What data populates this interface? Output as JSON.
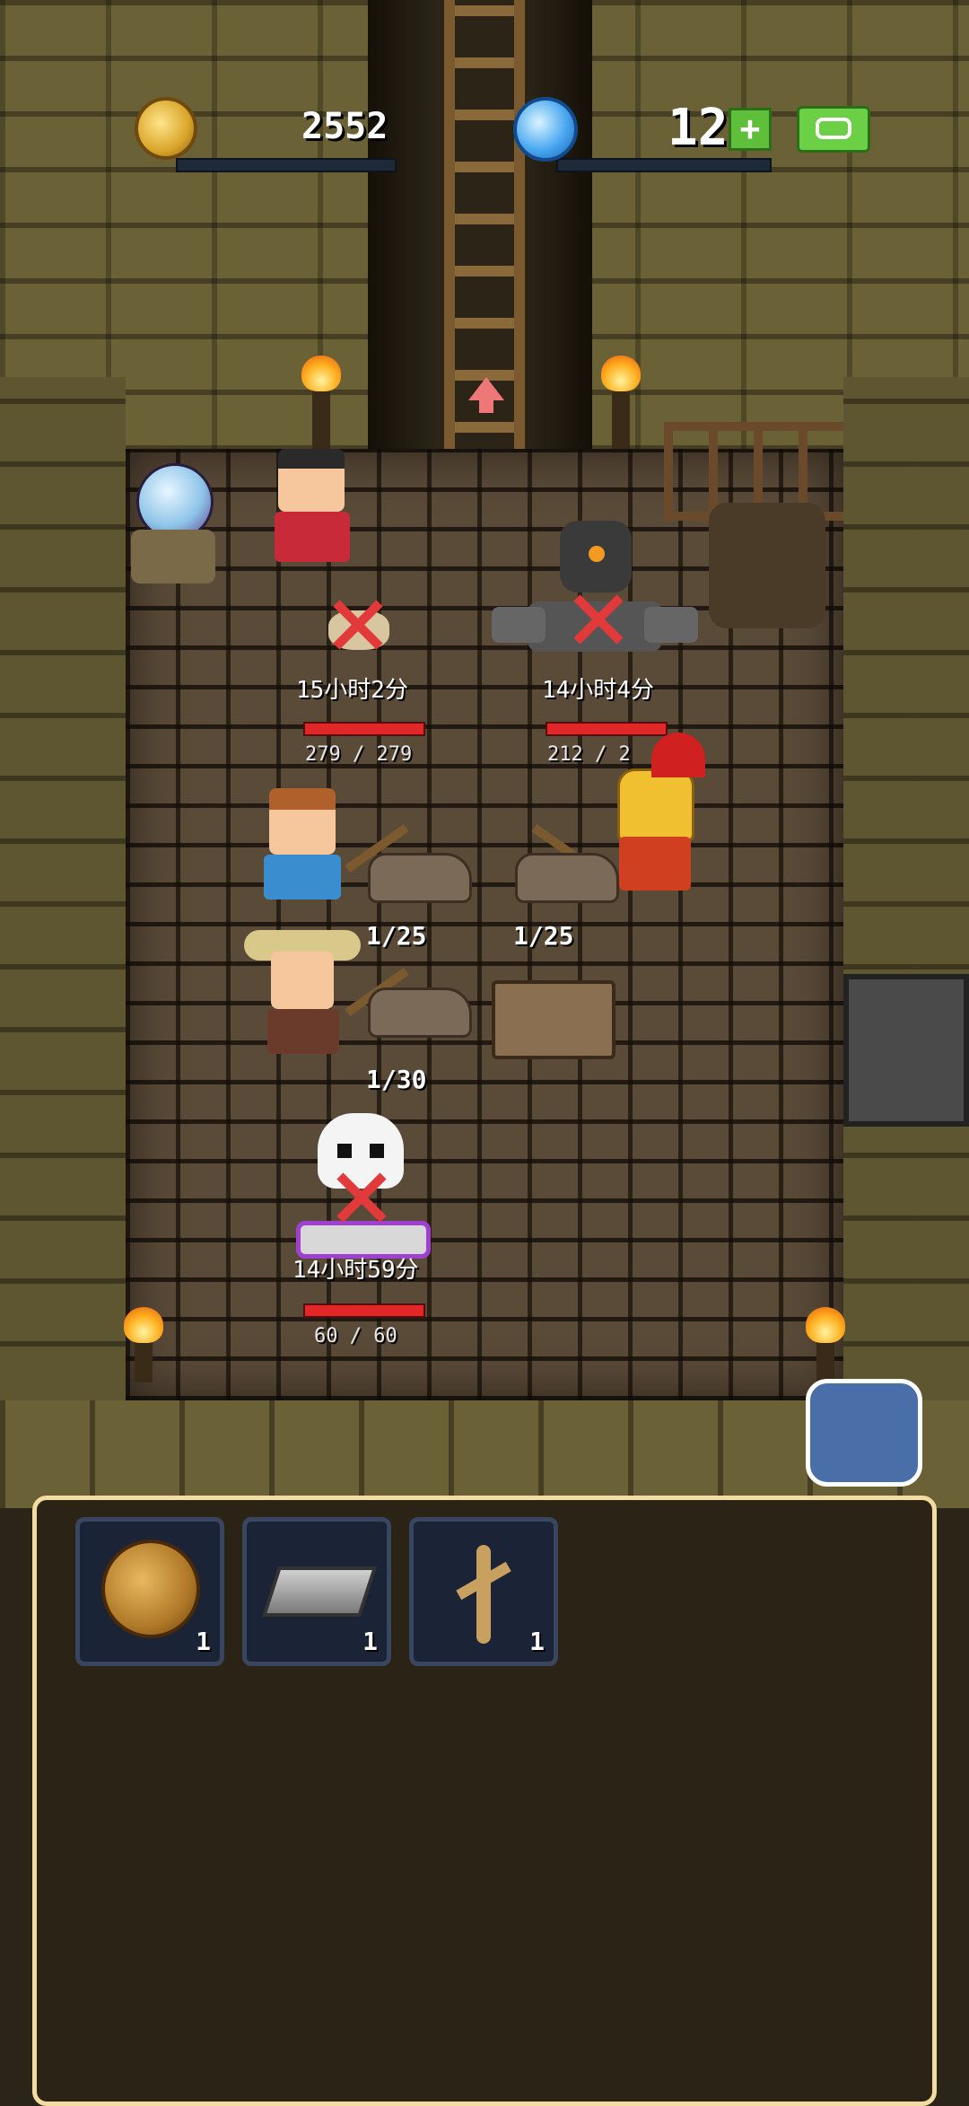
{
  "hud": {
    "gold": "2552",
    "gems": "12",
    "plus_symbol": "+"
  },
  "monsters": [
    {
      "name": "bat",
      "timer": "15小时2分",
      "hp": "279 / 279"
    },
    {
      "name": "golem",
      "timer": "14小时4分",
      "hp": "212 / 2"
    },
    {
      "name": "skeleton",
      "timer": "14小时59分",
      "hp": "60 / 60"
    }
  ],
  "mining": [
    {
      "progress": "1/25"
    },
    {
      "progress": "1/25"
    },
    {
      "progress": "1/30"
    }
  ],
  "inventory": [
    {
      "icon": "gold-coin-icon",
      "qty": "1"
    },
    {
      "icon": "iron-ingot-icon",
      "qty": "1"
    },
    {
      "icon": "root-icon",
      "qty": "1"
    }
  ],
  "colors": {
    "panel_border": "#f3dca2",
    "hp_bar": "#e02828",
    "plus_button": "#5fbf3a"
  }
}
